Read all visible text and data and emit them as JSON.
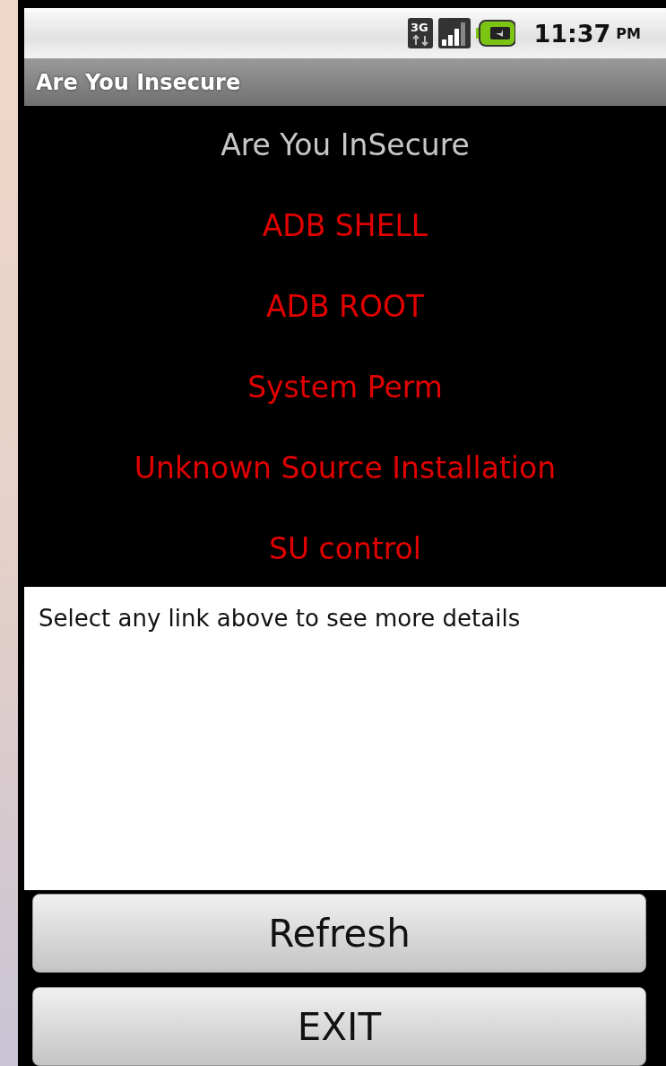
{
  "status_bar": {
    "network": "3G",
    "time": "11:37",
    "ampm": "PM"
  },
  "title_bar": {
    "title": "Are You Insecure"
  },
  "heading": "Are You InSecure",
  "links": [
    "ADB SHELL",
    "ADB ROOT",
    "System Perm",
    "Unknown Source Installation",
    "SU control"
  ],
  "details": {
    "text": "Select any link above to see more details"
  },
  "buttons": [
    "Refresh",
    "EXIT"
  ]
}
